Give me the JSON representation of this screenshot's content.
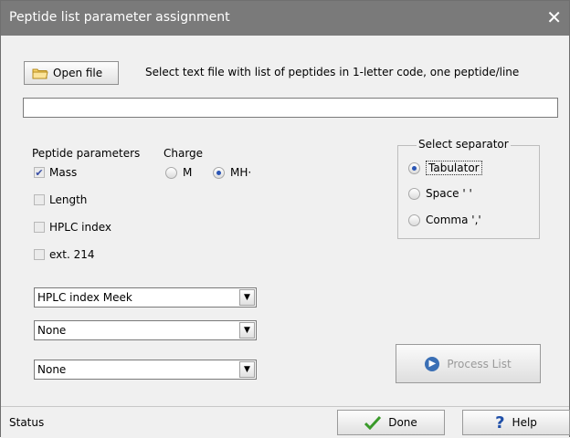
{
  "window": {
    "title": "Peptide list parameter assignment",
    "close_glyph": "✕"
  },
  "file": {
    "open_button_label": "Open file",
    "hint": "Select text file with list of peptides in 1-letter code, one peptide/line",
    "path_value": ""
  },
  "peptide_parameters": {
    "label": "Peptide parameters",
    "items": [
      {
        "label": "Mass",
        "checked": true
      },
      {
        "label": "Length",
        "checked": false
      },
      {
        "label": "HPLC index",
        "checked": false
      },
      {
        "label": "ext. 214",
        "checked": false
      }
    ]
  },
  "charge": {
    "label": "Charge",
    "options": [
      {
        "label": "M",
        "selected": false
      },
      {
        "label": "MH·",
        "selected": true
      }
    ]
  },
  "separator": {
    "label": "Select separator",
    "options": [
      {
        "label": "Tabulator",
        "selected": true
      },
      {
        "label": "Space ' '",
        "selected": false
      },
      {
        "label": "Comma ','",
        "selected": false
      }
    ]
  },
  "dropdowns": [
    {
      "value": "HPLC index Meek"
    },
    {
      "value": "None"
    },
    {
      "value": "None"
    }
  ],
  "process_button": {
    "label": "Process List",
    "enabled": false
  },
  "status": {
    "text": "Status"
  },
  "footer": {
    "done_label": "Done",
    "help_label": "Help"
  },
  "colors": {
    "titlebar": "#7a7a7a",
    "accent": "#2a55b5",
    "done_check": "#3a9a2a",
    "help_mark": "#1f4fa8"
  },
  "icons": {
    "open": "folder-icon",
    "process": "info-icon",
    "done": "checkmark-icon",
    "help": "question-icon"
  }
}
